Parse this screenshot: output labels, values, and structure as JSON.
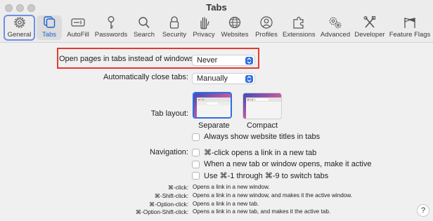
{
  "window": {
    "title": "Tabs"
  },
  "toolbar": {
    "items": [
      {
        "label": "General",
        "icon": "gear-icon"
      },
      {
        "label": "Tabs",
        "icon": "tabs-icon"
      },
      {
        "label": "AutoFill",
        "icon": "autofill-icon"
      },
      {
        "label": "Passwords",
        "icon": "key-icon"
      },
      {
        "label": "Search",
        "icon": "search-icon"
      },
      {
        "label": "Security",
        "icon": "lock-icon"
      },
      {
        "label": "Privacy",
        "icon": "hand-icon"
      },
      {
        "label": "Websites",
        "icon": "globe-icon"
      },
      {
        "label": "Profiles",
        "icon": "person-icon"
      },
      {
        "label": "Extensions",
        "icon": "puzzle-icon"
      },
      {
        "label": "Advanced",
        "icon": "gears-icon"
      },
      {
        "label": "Developer",
        "icon": "tools-icon"
      },
      {
        "label": "Feature Flags",
        "icon": "flags-icon"
      }
    ]
  },
  "settings": {
    "open_pages": {
      "label": "Open pages in tabs instead of windows:",
      "value": "Never"
    },
    "auto_close": {
      "label": "Automatically close tabs:",
      "value": "Manually"
    },
    "tab_layout": {
      "label": "Tab layout:",
      "options": [
        "Separate",
        "Compact"
      ],
      "selected": "Separate"
    },
    "always_show_titles": {
      "label": "Always show website titles in tabs",
      "checked": false
    },
    "navigation": {
      "label": "Navigation:",
      "options": [
        {
          "label": "⌘-click opens a link in a new tab",
          "checked": false
        },
        {
          "label": "When a new tab or window opens, make it active",
          "checked": false
        },
        {
          "label": "Use ⌘-1 through ⌘-9 to switch tabs",
          "checked": false
        }
      ]
    },
    "shortcuts": [
      {
        "key": "⌘-click:",
        "desc": "Opens a link in a new window."
      },
      {
        "key": "⌘-Shift-click:",
        "desc": "Opens a link in a new window, and makes it the active window."
      },
      {
        "key": "⌘-Option-click:",
        "desc": "Opens a link in a new tab."
      },
      {
        "key": "⌘-Option-Shift-click:",
        "desc": "Opens a link in a new tab, and makes it the active tab."
      }
    ]
  },
  "help": {
    "label": "?"
  },
  "colors": {
    "accent": "#2f6fe0",
    "highlight": "#e23b2f",
    "selected_ring": "#6f8fe6"
  }
}
